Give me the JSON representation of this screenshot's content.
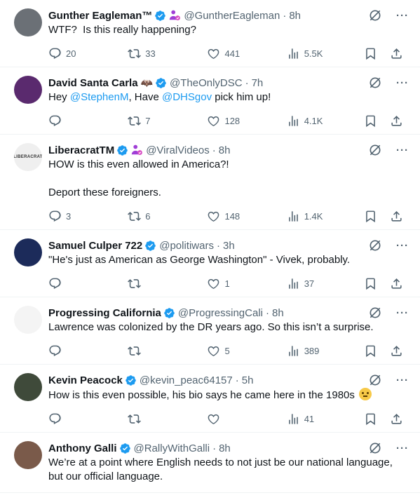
{
  "tweets": [
    {
      "name": "Gunther Eagleman™",
      "extra": "",
      "affiliate": true,
      "handle": "@GuntherEagleman",
      "time": "8h",
      "text_parts": [
        {
          "t": "WTF?  Is this really happening?",
          "m": false
        }
      ],
      "replies": "20",
      "reposts": "33",
      "likes": "441",
      "views": "5.5K",
      "avatar_color": "#6b7076",
      "avatar_label": ""
    },
    {
      "name": "David Santa Carla",
      "extra": "🦇",
      "affiliate": false,
      "handle": "@TheOnlyDSC",
      "time": "7h",
      "text_parts": [
        {
          "t": "Hey ",
          "m": false
        },
        {
          "t": "@StephenM",
          "m": true
        },
        {
          "t": ", Have ",
          "m": false
        },
        {
          "t": "@DHSgov",
          "m": true
        },
        {
          "t": " pick him up!",
          "m": false
        }
      ],
      "replies": "",
      "reposts": "7",
      "likes": "128",
      "views": "4.1K",
      "avatar_color": "#5a2a6e",
      "avatar_label": ""
    },
    {
      "name": "LiberacratTM",
      "extra": "",
      "affiliate": true,
      "handle": "@ViralVideos",
      "time": "8h",
      "text_parts": [
        {
          "t": "HOW is this even allowed in America?!\n\nDeport these foreigners.",
          "m": false
        }
      ],
      "replies": "3",
      "reposts": "6",
      "likes": "148",
      "views": "1.4K",
      "avatar_color": "#efefef",
      "avatar_label": "LIBERACRAT"
    },
    {
      "name": "Samuel Culper 722",
      "extra": "",
      "affiliate": false,
      "handle": "@politiwars",
      "time": "3h",
      "text_parts": [
        {
          "t": "\"He's just as American as George Washington\" - Vivek, probably.",
          "m": false
        }
      ],
      "replies": "",
      "reposts": "",
      "likes": "1",
      "views": "37",
      "avatar_color": "#1c2b5a",
      "avatar_label": ""
    },
    {
      "name": "Progressing California",
      "extra": "",
      "affiliate": false,
      "handle": "@ProgressingCali",
      "time": "8h",
      "text_parts": [
        {
          "t": "Lawrence was colonized by the DR years ago. So this isn’t a surprise.",
          "m": false
        }
      ],
      "replies": "",
      "reposts": "",
      "likes": "5",
      "views": "389",
      "avatar_color": "#f4f4f4",
      "avatar_label": ""
    },
    {
      "name": "Kevin Peacock",
      "extra": "",
      "affiliate": false,
      "handle": "@kevin_peac64157",
      "time": "5h",
      "text_parts": [
        {
          "t": "How is this even possible, his bio says he came here in the 1980s",
          "m": false
        }
      ],
      "emoji": true,
      "replies": "",
      "reposts": "",
      "likes": "",
      "views": "41",
      "avatar_color": "#3f4a3a",
      "avatar_label": ""
    },
    {
      "name": "Anthony Galli",
      "extra": "",
      "affiliate": false,
      "handle": "@RallyWithGalli",
      "time": "8h",
      "text_parts": [
        {
          "t": "We’re at a point where English needs to not just be our national language, but our official language.",
          "m": false
        }
      ],
      "replies": "",
      "reposts": "",
      "likes": "",
      "views": "",
      "avatar_color": "#7a5a4a",
      "avatar_label": "",
      "no_actions": true
    }
  ],
  "colors": {
    "accent": "#1d9bf0",
    "muted": "#536471",
    "affiliate": "#a03ed6"
  },
  "icons": [
    "verified-badge-icon",
    "affiliate-badge-icon",
    "grok-icon",
    "more-icon",
    "reply-icon",
    "repost-icon",
    "like-icon",
    "views-icon",
    "bookmark-icon",
    "share-icon"
  ]
}
